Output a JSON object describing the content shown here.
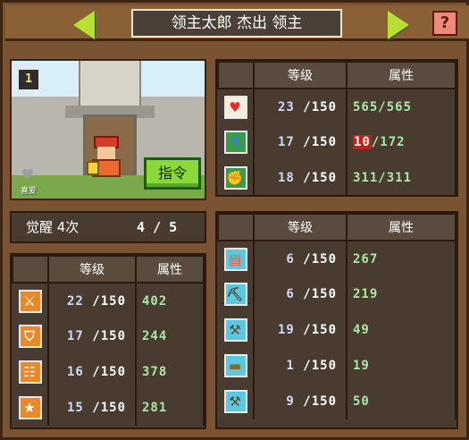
{
  "header": {
    "title": "领主太郎 杰出 领主",
    "help": "?"
  },
  "portrait": {
    "level_badge": "1",
    "favorite_label": "喜爱",
    "command_button": "指令"
  },
  "awaken": {
    "label": "觉醒 4次",
    "current": "4",
    "separator": "/",
    "max": "5"
  },
  "top_stats": {
    "headers": [
      "等级",
      "属性"
    ],
    "rows": [
      {
        "icon": "heart-icon",
        "icon_bg": "#e82a2a",
        "level": "23",
        "level_max": "/150",
        "attr": "565/565",
        "attr_highlight": false
      },
      {
        "icon": "potion-icon",
        "icon_bg": "#3a7ae8",
        "level": "17",
        "level_max": "/150",
        "attr_hl": "10",
        "attr_rest": "/172",
        "attr_highlight": true
      },
      {
        "icon": "arm-icon",
        "icon_bg": "#f0c840",
        "level": "18",
        "level_max": "/150",
        "attr": "311/311",
        "attr_highlight": false
      }
    ]
  },
  "left_stats": {
    "headers": [
      "等级",
      "属性"
    ],
    "rows": [
      {
        "icon": "sword-icon",
        "level": "22",
        "level_max": "/150",
        "attr": "402"
      },
      {
        "icon": "shield-icon",
        "level": "17",
        "level_max": "/150",
        "attr": "244"
      },
      {
        "icon": "ladder-icon",
        "level": "16",
        "level_max": "/150",
        "attr": "378"
      },
      {
        "icon": "star-icon",
        "level": "15",
        "level_max": "/150",
        "attr": "281"
      }
    ]
  },
  "right_stats": {
    "headers": [
      "等级",
      "属性"
    ],
    "rows": [
      {
        "icon": "book-icon",
        "level": "6",
        "level_max": "/150",
        "attr": "267"
      },
      {
        "icon": "pickaxe-icon",
        "level": "6",
        "level_max": "/150",
        "attr": "219"
      },
      {
        "icon": "shovel-icon",
        "level": "19",
        "level_max": "/150",
        "attr": "49"
      },
      {
        "icon": "anvil-icon",
        "level": "1",
        "level_max": "/150",
        "attr": "19"
      },
      {
        "icon": "axe-icon",
        "level": "9",
        "level_max": "/150",
        "attr": "50"
      }
    ]
  }
}
